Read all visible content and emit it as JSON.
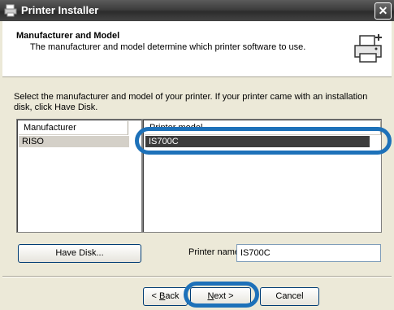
{
  "window": {
    "title": "Printer Installer",
    "close_glyph": "✕"
  },
  "header": {
    "title": "Manufacturer and Model",
    "subtitle": "The manufacturer and model determine which printer software to use."
  },
  "instruction": "Select the manufacturer and model of your printer. If your printer came with an installation disk, click Have Disk.",
  "manufacturer_list": {
    "header": "Manufacturer",
    "items": [
      "RISO"
    ],
    "selected": "RISO"
  },
  "model_list": {
    "header": "Printer model",
    "items": [
      "IS700C"
    ],
    "selected": "IS700C"
  },
  "buttons": {
    "have_disk": "Have Disk...",
    "back_accel": "B",
    "back_rest": "ack",
    "back_prefix": "< ",
    "next_accel": "N",
    "next_rest": "ext >",
    "cancel": "Cancel"
  },
  "printer_name": {
    "label": "Printer name:",
    "value": "IS700C"
  },
  "colors": {
    "accent": "#1d71b9",
    "selection": "#3c3c3c"
  },
  "icons": [
    "printer-app-icon",
    "close-icon",
    "printer-add-icon"
  ]
}
